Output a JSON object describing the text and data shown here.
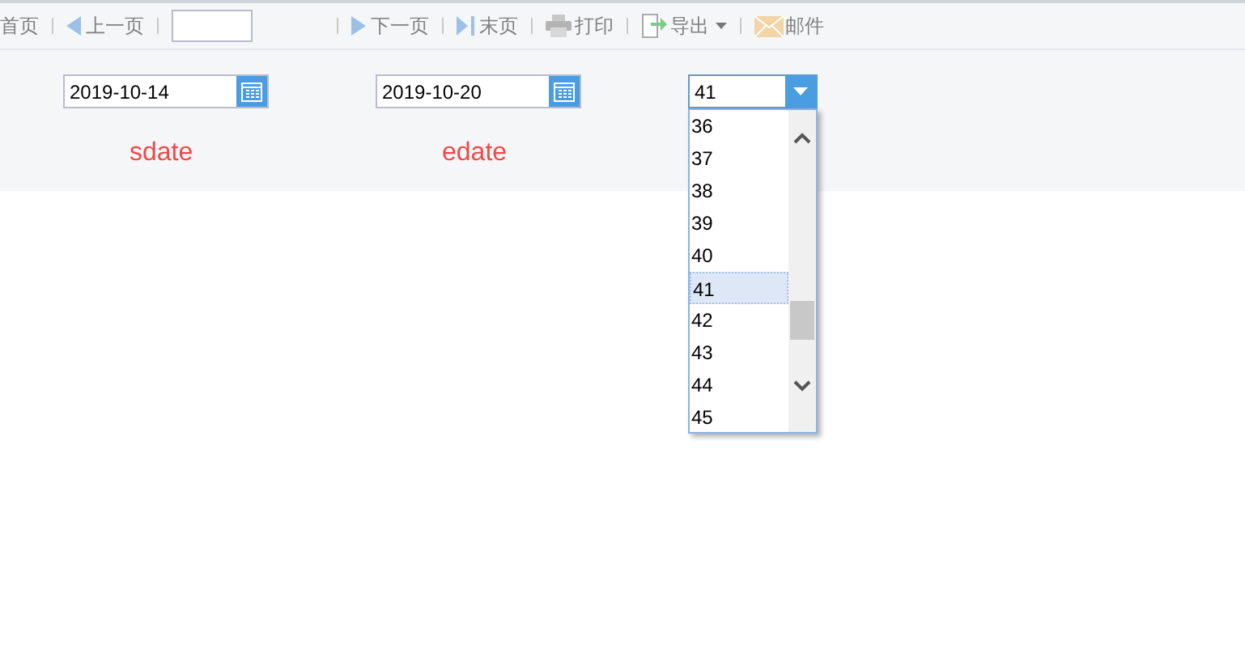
{
  "toolbar": [
    {
      "kind": "text",
      "label": "首页",
      "disabled": true
    },
    {
      "kind": "prev",
      "label": "上一页",
      "disabled": true
    },
    {
      "kind": "page-input"
    },
    {
      "kind": "next",
      "label": "下一页",
      "disabled": true
    },
    {
      "kind": "last",
      "label": "末页",
      "disabled": true
    },
    {
      "kind": "print",
      "label": "打印",
      "disabled": true
    },
    {
      "kind": "export",
      "label": "导出",
      "disabled": true
    },
    {
      "kind": "mail",
      "label": "邮件",
      "disabled": true
    }
  ],
  "filters": [
    {
      "kind": "date",
      "value": "2019-10-14",
      "caption": "sdate"
    },
    {
      "kind": "date",
      "value": "2019-10-20",
      "caption": "edate"
    },
    {
      "kind": "select",
      "value": "41",
      "expanded": true,
      "options": [
        {
          "label": "36",
          "selected": false
        },
        {
          "label": "37",
          "selected": false
        },
        {
          "label": "38",
          "selected": false
        },
        {
          "label": "39",
          "selected": false
        },
        {
          "label": "40",
          "selected": false
        },
        {
          "label": "41",
          "selected": true
        },
        {
          "label": "42",
          "selected": false
        },
        {
          "label": "43",
          "selected": false
        },
        {
          "label": "44",
          "selected": false
        },
        {
          "label": "45",
          "selected": false
        }
      ]
    }
  ]
}
